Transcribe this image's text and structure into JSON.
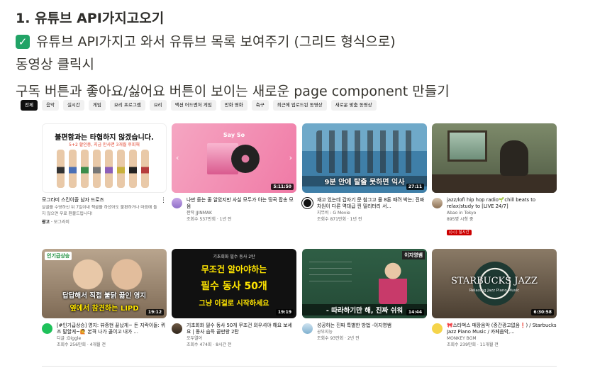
{
  "notes": {
    "heading": "1. 유튜브 API가지고오기",
    "line1": "유튜브 API가지고 와서 유튜브 목록 보여주기 (그리드 형식으로)",
    "line2": "동영상 클릭시",
    "line3": "구독 버튼과 좋아요/싫어요 버튼이 보이는 새로운 page component 만들기"
  },
  "chips": [
    "전체",
    "음악",
    "실시간",
    "게임",
    "요리 프로그램",
    "요리",
    "액션 어드벤처 게임",
    "만화 영화",
    "축구",
    "최근에 업로드된 동영상",
    "새로운 맞춤 동영상"
  ],
  "ad": {
    "thumb_title": "불편함과는 타협하지 않겠습니다.",
    "thumb_sub": "5+2 할인중, 지금 만사면 3개월 후회해",
    "title": "모그라미 스킨이즐 남자 드로즈",
    "body": "살골을 수영하신 뒤 7일이내 책굴을 하셨어도 불편하거나 마음에 들지 않으면 무료 환불드립니다!",
    "badge": "광고",
    "advertiser": "모그라미"
  },
  "videos": [
    {
      "title": "나만 듣는 줄 알았지만 사실 모두가 아는 띵곡 팝송 모음",
      "channel": "짠딱 JJINMAK",
      "stats": "조회수 537만회 · 1년 전",
      "duration": "5:11:50",
      "overlay": "Say So"
    },
    {
      "title": "재고 있는데 갑자기 문 참그고 물 8톤 때려 박는; 진짜 차원이 다른 역대급 찐 밀리터리 서...",
      "channel": "지무비 : G Movie",
      "stats": "조회수 871만회 · 1년 전",
      "duration": "27:11",
      "overlay": "9분 안에 탈출 못하면 익사"
    },
    {
      "title": "jazz/lofi hip hop radio🌱chill beats to relax/study to [LIVE 24/7]",
      "channel": "Abao in Tokyo",
      "stats": "895명 시청 중",
      "live": "실시간"
    },
    {
      "title": "[#인기급상승] 영지: 뷰증현 끝났게~ 돈 지락이들: 퀴즈 말할게~🙋 본격 나가 끓이고 내가 ...",
      "channel": "디글 :Diggle",
      "stats": "조회수 256만회 · 4개월 전",
      "duration": "19:12",
      "overlay_top": "인기급상승",
      "overlay1": "답답해서 직접 불닭 끓인 영지",
      "overlay2": "옆에서 참견하는 LIPD"
    },
    {
      "title": "기초회화 필수 동사 50개 무조건 외우셔야 해요 보세요 | 동사 습득 끝판왕 2탄",
      "channel": "오두열어",
      "stats": "조회수 474회 · 8시간 전",
      "duration": "19:19",
      "overlay_top": "기초회화 필수 동사 2탄",
      "overlay1": "무조건 알아야하는",
      "overlay2": "필수 동사 50개",
      "overlay3": "그냥 이걸로 시작하세요"
    },
    {
      "title": "성공하는 진짜 특별한 방법 -이지영쌤",
      "channel": "공부지능",
      "stats": "조회수 93만회 · 2년 전",
      "duration": "14:44",
      "overlay_top": "이지영쌤",
      "overlay1": "- 따라하기만 해, 진짜 쉬워"
    },
    {
      "title": "🎀스타벅스 매장음악 (중간광고없음❗) / Starbucks Jazz Piano Music / 카페음악,...",
      "channel": "MONKEY BGM",
      "stats": "조회수 239만회 · 11개월 전",
      "duration": "6:30:58",
      "overlay1": "STARBUCKS JAZZ",
      "overlay2": "Relaxing Jazz Piano Music"
    }
  ],
  "colors": {
    "check_green": "#21a366",
    "live_red": "#cc0000",
    "text": "#37352f"
  }
}
